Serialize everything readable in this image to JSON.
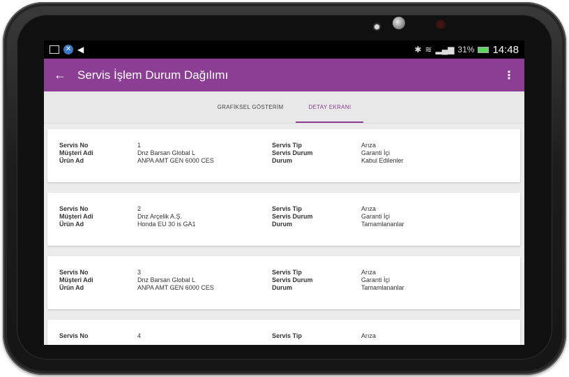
{
  "statusbar": {
    "signal": "31%",
    "time": "14:48"
  },
  "appbar": {
    "back_icon": "←",
    "title": "Servis İşlem Durum Dağılımı",
    "menu_icon": "⋮"
  },
  "tabs": [
    {
      "label": "GRAFİKSEL GÖSTERİM",
      "active": false
    },
    {
      "label": "DETAY EKRANI",
      "active": true
    }
  ],
  "labels": {
    "servis_no": "Servis No",
    "musteri_adi": "Müşteri Adi",
    "urun_ad": "Ürün Ad",
    "servis_tip": "Servis Tip",
    "servis_durum": "Servis Durum",
    "durum": "Durum"
  },
  "records": [
    {
      "servis_no": "1",
      "musteri_adi": "Dnz Barsan Global L",
      "urun_ad": "ANPA AMT GEN 6000 CES",
      "servis_tip": "Arıza",
      "servis_durum": "Garanti İçi",
      "durum": "Kabul Edilenler"
    },
    {
      "servis_no": "2",
      "musteri_adi": "Dnz Arçelik A.Ş.",
      "urun_ad": "Honda EU 30 is GA1",
      "servis_tip": "Arıza",
      "servis_durum": "Garanti İçi",
      "durum": "Tamamlananlar"
    },
    {
      "servis_no": "3",
      "musteri_adi": "Dnz Barsan Global L",
      "urun_ad": "ANPA AMT GEN 6000 CES",
      "servis_tip": "Arıza",
      "servis_durum": "Garanti İçi",
      "durum": "Tamamlananlar"
    },
    {
      "servis_no": "4",
      "musteri_adi": "",
      "urun_ad": "",
      "servis_tip": "Arıza",
      "servis_durum": "",
      "durum": ""
    }
  ]
}
